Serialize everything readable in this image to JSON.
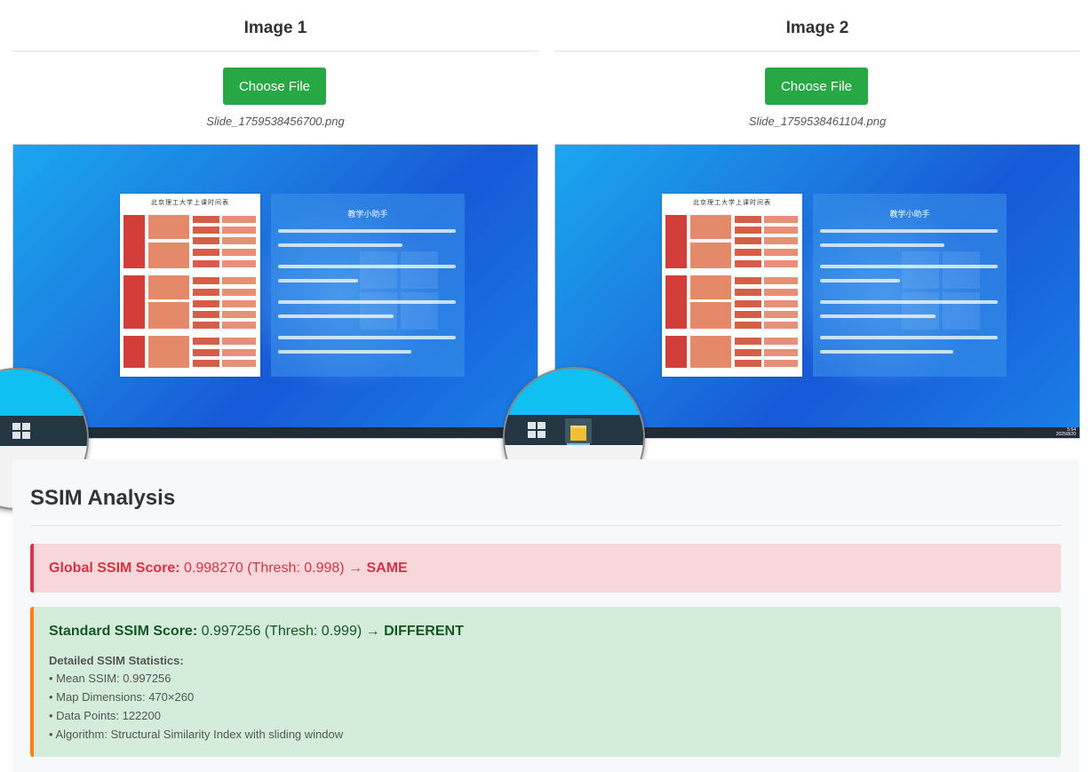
{
  "panels": [
    {
      "title": "Image 1",
      "button_label": "Choose File",
      "file_name": "Slide_1759538456700.png"
    },
    {
      "title": "Image 2",
      "button_label": "Choose File",
      "file_name": "Slide_1759538461104.png"
    }
  ],
  "slide": {
    "schedule_title": "北京理工大学上课时间表",
    "helper_title": "教学小助手",
    "clock_time": "5:54",
    "clock_date": "2025/8/20"
  },
  "analysis": {
    "title": "SSIM Analysis",
    "global": {
      "label": "Global SSIM Score:",
      "detail": " 0.998270 (Thresh: 0.998) → ",
      "verdict": "SAME"
    },
    "standard": {
      "label": "Standard SSIM Score:",
      "detail": " 0.997256 (Thresh: 0.999) → ",
      "verdict": "DIFFERENT",
      "stats_title": "Detailed SSIM Statistics:",
      "stats": [
        "• Mean SSIM: 0.997256",
        "• Map Dimensions: 470×260",
        "• Data Points: 122200",
        "• Algorithm: Structural Similarity Index with sliding window"
      ]
    }
  },
  "colors": {
    "button": "#28a745",
    "global_bg": "#f8d7da",
    "global_accent": "#dc3545",
    "standard_bg": "#d4edda",
    "standard_accent": "#fd7e14",
    "desktop": "#1c7be0"
  }
}
